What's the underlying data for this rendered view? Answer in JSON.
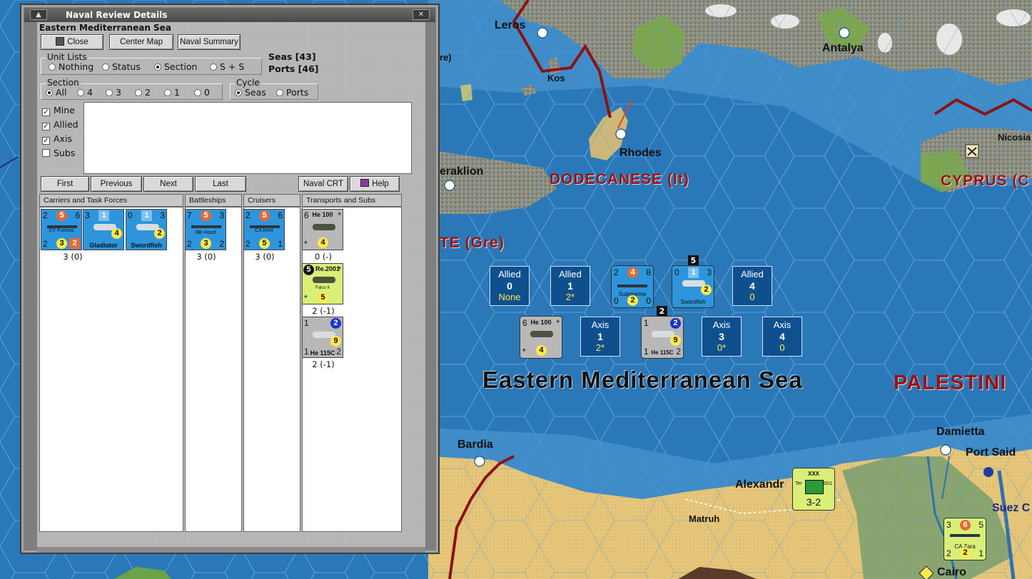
{
  "window": {
    "title": "Naval Review Details",
    "sea_name": "Eastern Mediterranean Sea"
  },
  "toolbar": {
    "close": "Close",
    "center_map": "Center Map",
    "naval_summary": "Naval Summary"
  },
  "unit_lists": {
    "label": "Unit Lists",
    "options": [
      "Nothing",
      "Status",
      "Section",
      "S + S"
    ],
    "selected": "Section"
  },
  "counts": {
    "seas": "Seas [43]",
    "ports": "Ports [46]"
  },
  "section": {
    "label": "Section",
    "options": [
      "All",
      "4",
      "3",
      "2",
      "1",
      "0"
    ],
    "selected": "All"
  },
  "cycle": {
    "label": "Cycle",
    "options": [
      "Seas",
      "Ports"
    ],
    "selected": "Seas"
  },
  "filters": [
    {
      "label": "Mine",
      "checked": true
    },
    {
      "label": "Allied",
      "checked": true
    },
    {
      "label": "Axis",
      "checked": true
    },
    {
      "label": "Subs",
      "checked": false
    }
  ],
  "nav": {
    "first": "First",
    "previous": "Previous",
    "next": "Next",
    "last": "Last",
    "naval_crt": "Naval CRT",
    "help": "Help"
  },
  "columns": {
    "carriers": "Carriers and Task Forces",
    "battleships": "Battleships",
    "cruisers": "Cruisers",
    "transports": "Transports and Subs"
  },
  "dialog_units": {
    "cv": {
      "tl": "2",
      "att": "5",
      "tr": "6",
      "name": "CV Furious",
      "bl": "2",
      "def": "3",
      "cap": "2",
      "stack": "3 (0)"
    },
    "gladiator": {
      "tl": "3",
      "badge": "1",
      "fac": "4",
      "name": "Gladiator"
    },
    "swordfish": {
      "tl": "0",
      "badge": "1",
      "tr": "3",
      "fac": "2",
      "name": "Swordfish"
    },
    "bb": {
      "tl": "7",
      "att": "5",
      "tr": "3",
      "name": "BB Hood",
      "bl": "2",
      "def": "3",
      "br": "2",
      "stack": "3 (0)"
    },
    "ca": {
      "tl": "2",
      "att": "5",
      "tr": "6",
      "name": "CA Kent",
      "bl": "2",
      "def": "5",
      "br": "1",
      "stack": "3 (0)"
    },
    "he100": {
      "tl": "6",
      "name": "He 100",
      "tr": "*",
      "bl": "*",
      "fac": "4",
      "stack": "0 (-)"
    },
    "re2001": {
      "badge": "5",
      "name": "Re.2001",
      "tr": "*",
      "sub": "Falco II",
      "bl": "*",
      "fac": "5",
      "stack": "2 (-1)"
    },
    "he115": {
      "tl": "1",
      "badge": "2",
      "fac": "9",
      "bl": "1",
      "name": "He 115C",
      "br": "2",
      "stack": "2 (-1)"
    }
  },
  "map_labels": {
    "leros": "Leros",
    "kos": "Kos",
    "rhodes": "Rhodes",
    "antalya": "Antalya",
    "nicosia": "Nicosia",
    "heraklion": "eraklion",
    "re": "re)",
    "bardia": "Bardia",
    "damietta": "Damietta",
    "port_said": "Port Said",
    "alexandria": "Alexandr",
    "matruh": "Matruh",
    "suez": "Suez C",
    "cairo": "Cairo"
  },
  "regions": {
    "dodecanese": "DODECANESE (It)",
    "cyprus": "CYPRUS (C",
    "crete": "TE (Gre)",
    "palestine": "PALESTINI",
    "sea": "Eastern Mediterranean Sea"
  },
  "sea_boxes": [
    {
      "side": "Allied",
      "num": "0",
      "sub": "None"
    },
    {
      "side": "Allied",
      "num": "1",
      "sub": "2*"
    },
    {
      "side": "Allied",
      "num": "4",
      "sub": "0"
    },
    {
      "side": "Axis",
      "num": "1",
      "sub": "2*"
    },
    {
      "side": "Axis",
      "num": "3",
      "sub": "0*"
    },
    {
      "side": "Axis",
      "num": "4",
      "sub": "0"
    }
  ],
  "map_units": {
    "submarine": {
      "tl": "2",
      "att": "4",
      "tr": "8",
      "name": "Submarine",
      "bl": "0",
      "def": "2",
      "br": "0"
    },
    "swordfish": {
      "stack": "5",
      "tl": "0",
      "badge": "1",
      "tr": "3",
      "fac": "2",
      "name": "Swordfish"
    },
    "he100": {
      "tl": "6",
      "name": "He 100",
      "tr": "*",
      "bl": "*",
      "fac": "4"
    },
    "he115": {
      "stack": "2",
      "tl": "1",
      "badge": "2",
      "fac": "9",
      "bl": "1",
      "name": "He 115C",
      "br": "2"
    },
    "alex_unit": {
      "size": "XXX",
      "left": "Ter",
      "right": "Sh1",
      "str": "3-2"
    },
    "cazara": {
      "tl": "3",
      "att": "6",
      "tr": "5",
      "name": "CA Zara",
      "bl": "2",
      "def": "2",
      "br": "1"
    }
  },
  "colors": {
    "sea": "#2b78b8",
    "region_red": "#9b1215",
    "allied_blue": "#2e95dc",
    "axis_grey": "#b8b8b8",
    "italy_lime": "#d9ef77"
  }
}
